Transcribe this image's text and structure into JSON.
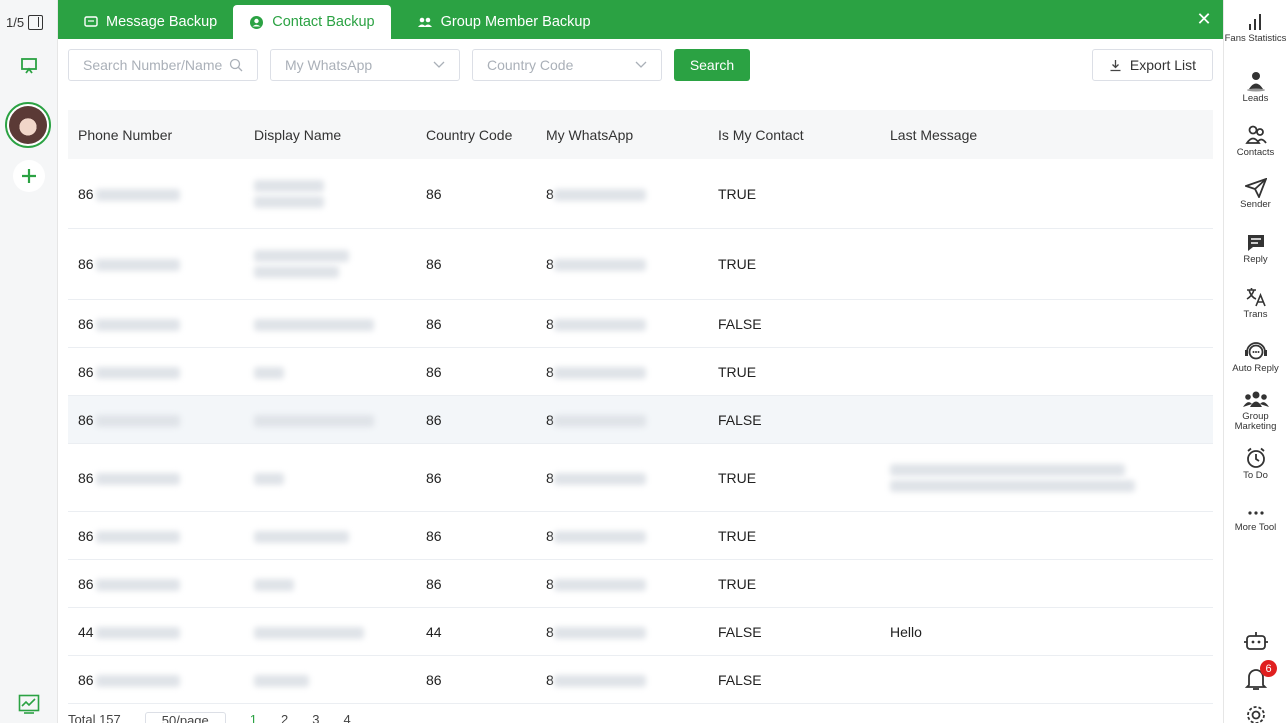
{
  "left_rail": {
    "page_indicator": "1/5"
  },
  "tabs": [
    {
      "label": "Message Backup",
      "icon": "chat-icon",
      "active": false
    },
    {
      "label": "Contact Backup",
      "icon": "user-circle-icon",
      "active": true
    },
    {
      "label": "Group Member Backup",
      "icon": "group-icon",
      "active": false
    }
  ],
  "filters": {
    "search_placeholder": "Search Number/Name",
    "whatsapp_placeholder": "My WhatsApp",
    "country_placeholder": "Country Code",
    "search_button": "Search",
    "export_button": "Export List"
  },
  "table": {
    "columns": [
      "Phone Number",
      "Display Name",
      "Country Code",
      "My WhatsApp",
      "Is My Contact",
      "Last Message"
    ],
    "rows": [
      {
        "phone_prefix": "86",
        "country": "86",
        "my_wa_prefix": "8",
        "is_contact": "TRUE",
        "last_message": ""
      },
      {
        "phone_prefix": "86",
        "country": "86",
        "my_wa_prefix": "8",
        "is_contact": "TRUE",
        "last_message": ""
      },
      {
        "phone_prefix": "86",
        "country": "86",
        "my_wa_prefix": "8",
        "is_contact": "FALSE",
        "last_message": ""
      },
      {
        "phone_prefix": "86",
        "country": "86",
        "my_wa_prefix": "8",
        "is_contact": "TRUE",
        "last_message": ""
      },
      {
        "phone_prefix": "86",
        "country": "86",
        "my_wa_prefix": "8",
        "is_contact": "FALSE",
        "last_message": ""
      },
      {
        "phone_prefix": "86",
        "country": "86",
        "my_wa_prefix": "8",
        "is_contact": "TRUE",
        "last_message": ""
      },
      {
        "phone_prefix": "86",
        "country": "86",
        "my_wa_prefix": "8",
        "is_contact": "TRUE",
        "last_message": ""
      },
      {
        "phone_prefix": "86",
        "country": "86",
        "my_wa_prefix": "8",
        "is_contact": "TRUE",
        "last_message": ""
      },
      {
        "phone_prefix": "44",
        "country": "44",
        "my_wa_prefix": "8",
        "is_contact": "FALSE",
        "last_message": "Hello"
      },
      {
        "phone_prefix": "86",
        "country": "86",
        "my_wa_prefix": "8",
        "is_contact": "FALSE",
        "last_message": ""
      }
    ]
  },
  "pagination": {
    "total": "Total 157",
    "page_size": "50/page",
    "pages": [
      "1",
      "2",
      "3",
      "4"
    ],
    "current": "1"
  },
  "right_tools": [
    {
      "label": "Fans Statistics",
      "icon": "bar-chart-icon"
    },
    {
      "label": "Leads",
      "icon": "leads-icon"
    },
    {
      "label": "Contacts",
      "icon": "contacts-icon"
    },
    {
      "label": "Sender",
      "icon": "send-icon"
    },
    {
      "label": "Reply",
      "icon": "reply-icon"
    },
    {
      "label": "Trans",
      "icon": "translate-icon"
    },
    {
      "label": "Auto Reply",
      "icon": "auto-reply-icon"
    },
    {
      "label": "Group Marketing",
      "icon": "group-marketing-icon"
    },
    {
      "label": "To Do",
      "icon": "clock-icon"
    },
    {
      "label": "More Tool",
      "icon": "more-icon"
    }
  ],
  "notifications": {
    "count": "6"
  },
  "colors": {
    "brand": "#2ba243",
    "badge": "#e02020"
  }
}
